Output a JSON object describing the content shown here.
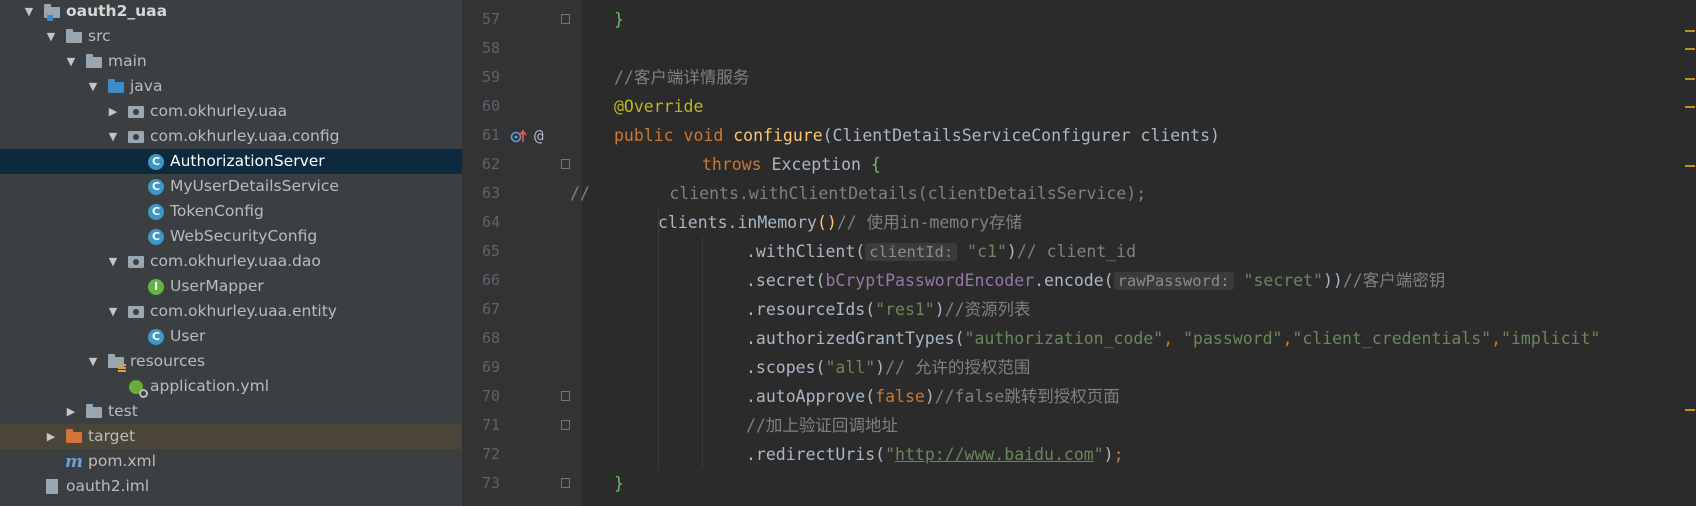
{
  "project_tree": {
    "items": [
      {
        "label": "oauth2_uaa",
        "icon": "module-folder-icon",
        "arrow": "expanded",
        "bold": true
      },
      {
        "label": "src",
        "icon": "folder-icon",
        "arrow": "expanded"
      },
      {
        "label": "main",
        "icon": "folder-icon",
        "arrow": "expanded"
      },
      {
        "label": "java",
        "icon": "source-folder-icon",
        "arrow": "expanded"
      },
      {
        "label": "com.okhurley.uaa",
        "icon": "package-icon",
        "arrow": "collapsed"
      },
      {
        "label": "com.okhurley.uaa.config",
        "icon": "package-icon",
        "arrow": "expanded"
      },
      {
        "label": "AuthorizationServer",
        "icon": "class-icon",
        "selected": true
      },
      {
        "label": "MyUserDetailsService",
        "icon": "class-icon"
      },
      {
        "label": "TokenConfig",
        "icon": "class-icon"
      },
      {
        "label": "WebSecurityConfig",
        "icon": "class-icon"
      },
      {
        "label": "com.okhurley.uaa.dao",
        "icon": "package-icon",
        "arrow": "expanded"
      },
      {
        "label": "UserMapper",
        "icon": "interface-icon"
      },
      {
        "label": "com.okhurley.uaa.entity",
        "icon": "package-icon",
        "arrow": "expanded"
      },
      {
        "label": "User",
        "icon": "class-icon"
      },
      {
        "label": "resources",
        "icon": "resources-folder-icon",
        "arrow": "expanded"
      },
      {
        "label": "application.yml",
        "icon": "yaml-file-icon"
      },
      {
        "label": "test",
        "icon": "folder-icon",
        "arrow": "collapsed"
      },
      {
        "label": "target",
        "icon": "excluded-folder-icon",
        "arrow": "collapsed",
        "excluded": true
      },
      {
        "label": "pom.xml",
        "icon": "maven-file-icon"
      },
      {
        "label": "oauth2.iml",
        "icon": "iml-file-icon"
      }
    ],
    "class_badge": "C",
    "interface_badge": "I",
    "maven_glyph": "m"
  },
  "editor": {
    "gutter_at_symbol": "@",
    "lines": [
      {
        "num": "57",
        "tokens": [
          {
            "t": "}",
            "c": "brg"
          }
        ]
      },
      {
        "num": "58",
        "tokens": []
      },
      {
        "num": "59",
        "tokens": [
          {
            "t": "//客户端详情服务",
            "c": "cm"
          }
        ]
      },
      {
        "num": "60",
        "tokens": [
          {
            "t": "@Override",
            "c": "ann"
          }
        ]
      },
      {
        "num": "61",
        "tokens": [
          {
            "t": "public void ",
            "c": "kw"
          },
          {
            "t": "configure",
            "c": "fn"
          },
          {
            "t": "(ClientDetailsServiceConfigurer clients)",
            "c": ""
          }
        ]
      },
      {
        "num": "62",
        "tokens": [
          {
            "t": "throws ",
            "c": "kw"
          },
          {
            "t": "Exception ",
            "c": ""
          },
          {
            "t": "{",
            "c": "brg"
          }
        ]
      },
      {
        "num": "63",
        "tokens": [
          {
            "t": "//        clients.withClientDetails(clientDetailsService);",
            "c": "cm"
          }
        ]
      },
      {
        "num": "64",
        "tokens": [
          {
            "t": "clients.inMemory",
            "c": ""
          },
          {
            "t": "()",
            "c": "fn"
          },
          {
            "t": "// 使用in-memory存储",
            "c": "cm"
          }
        ]
      },
      {
        "num": "65",
        "tokens": [
          {
            "t": ".withClient(",
            "c": ""
          },
          {
            "t": "clientId:",
            "c": "hint"
          },
          {
            "t": " ",
            "c": ""
          },
          {
            "t": "\"c1\"",
            "c": "str"
          },
          {
            "t": ")",
            "c": ""
          },
          {
            "t": "// client_id",
            "c": "cm"
          }
        ]
      },
      {
        "num": "66",
        "tokens": [
          {
            "t": ".secret(",
            "c": ""
          },
          {
            "t": "bCryptPasswordEncoder",
            "c": "fld"
          },
          {
            "t": ".encode(",
            "c": ""
          },
          {
            "t": "rawPassword:",
            "c": "hint"
          },
          {
            "t": " ",
            "c": ""
          },
          {
            "t": "\"secret\"",
            "c": "str"
          },
          {
            "t": "))",
            "c": ""
          },
          {
            "t": "//客户端密钥",
            "c": "cm"
          }
        ]
      },
      {
        "num": "67",
        "tokens": [
          {
            "t": ".resourceIds(",
            "c": ""
          },
          {
            "t": "\"res1\"",
            "c": "str"
          },
          {
            "t": ")",
            "c": ""
          },
          {
            "t": "//资源列表",
            "c": "cm"
          }
        ]
      },
      {
        "num": "68",
        "tokens": [
          {
            "t": ".authorizedGrantTypes(",
            "c": ""
          },
          {
            "t": "\"authorization_code\"",
            "c": "str"
          },
          {
            "t": ", ",
            "c": "kw"
          },
          {
            "t": "\"password\"",
            "c": "str"
          },
          {
            "t": ",",
            "c": "kw"
          },
          {
            "t": "\"client_credentials\"",
            "c": "str"
          },
          {
            "t": ",",
            "c": "kw"
          },
          {
            "t": "\"implicit\"",
            "c": "str"
          }
        ]
      },
      {
        "num": "69",
        "tokens": [
          {
            "t": ".scopes(",
            "c": ""
          },
          {
            "t": "\"all\"",
            "c": "str"
          },
          {
            "t": ")",
            "c": ""
          },
          {
            "t": "// 允许的授权范围",
            "c": "cm"
          }
        ]
      },
      {
        "num": "70",
        "tokens": [
          {
            "t": ".autoApprove(",
            "c": ""
          },
          {
            "t": "false",
            "c": "kw"
          },
          {
            "t": ")",
            "c": ""
          },
          {
            "t": "//false跳转到授权页面",
            "c": "cm"
          }
        ]
      },
      {
        "num": "71",
        "tokens": [
          {
            "t": "//加上验证回调地址",
            "c": "cm"
          }
        ]
      },
      {
        "num": "72",
        "tokens": [
          {
            "t": ".redirectUris(",
            "c": ""
          },
          {
            "t": "\"",
            "c": "str"
          },
          {
            "t": "http://www.baidu.com",
            "c": "lnk"
          },
          {
            "t": "\"",
            "c": "str"
          },
          {
            "t": ")",
            "c": ""
          },
          {
            "t": ";",
            "c": "kw"
          }
        ]
      },
      {
        "num": "73",
        "tokens": [
          {
            "t": "}",
            "c": "brg"
          }
        ]
      }
    ]
  }
}
